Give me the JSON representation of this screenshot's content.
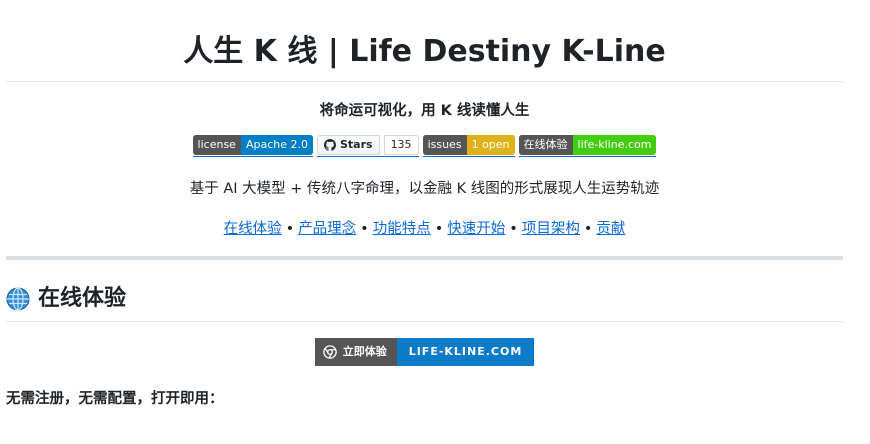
{
  "title": "人生 K 线 | Life Destiny K-Line",
  "tagline": "将命运可视化，用 K 线读懂人生",
  "badges": {
    "license": {
      "label": "license",
      "value": "Apache 2.0",
      "color": "#007ec6"
    },
    "stars": {
      "label": "Stars",
      "count": "135"
    },
    "issues": {
      "label": "issues",
      "value": "1 open",
      "color": "#dfb317"
    },
    "demo": {
      "label": "在线体验",
      "value": "life-kline.com",
      "color": "#4c1"
    }
  },
  "description": "基于 AI 大模型 + 传统八字命理，以金融 K 线图的形式展现人生运势轨迹",
  "nav": {
    "items": [
      "在线体验",
      "产品理念",
      "功能特点",
      "快速开始",
      "项目架构",
      "贡献"
    ],
    "separator": "•"
  },
  "section": {
    "heading": "在线体验",
    "icon": "globe-icon"
  },
  "cta": {
    "left": "立即体验",
    "right": "LIFE-KLINE.COM",
    "left_color": "#555555",
    "right_color": "#0c7bc8"
  },
  "note": "无需注册，无需配置，打开即用："
}
